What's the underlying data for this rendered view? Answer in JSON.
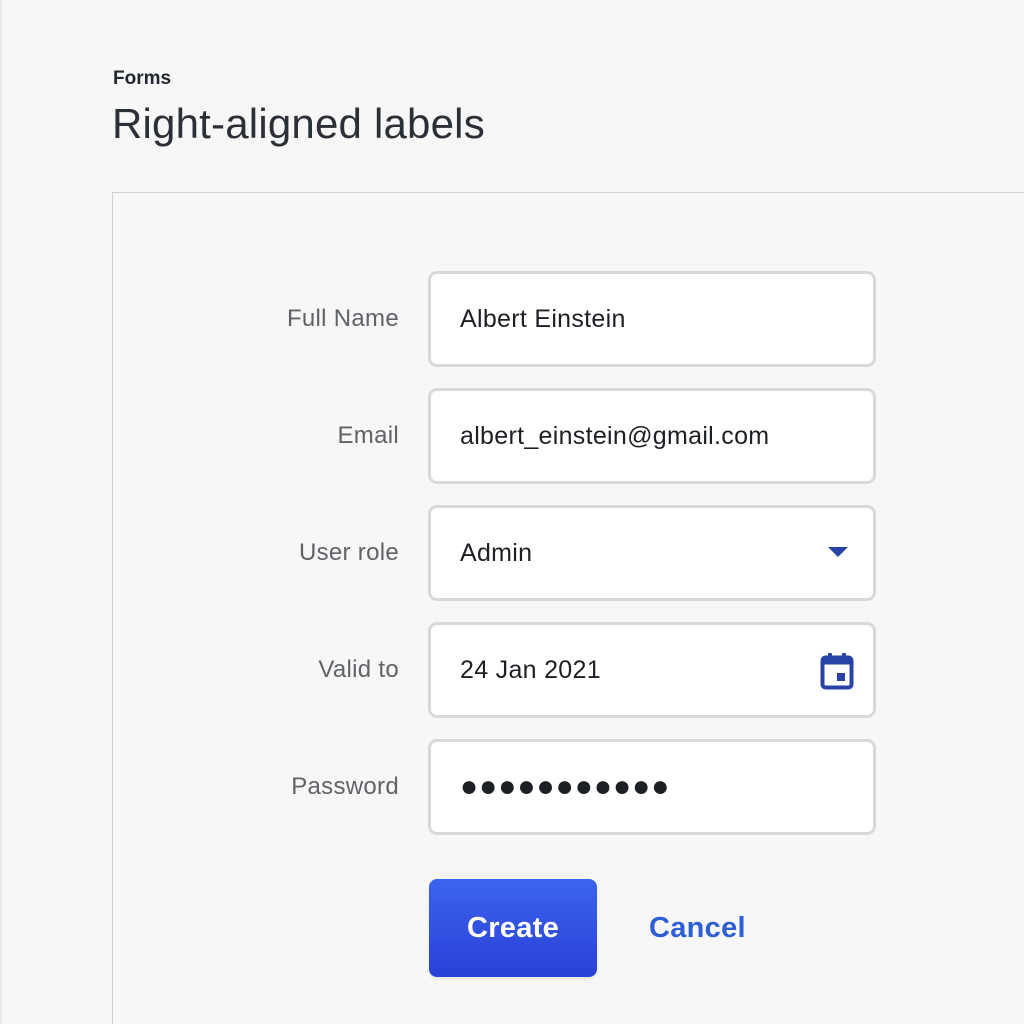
{
  "header": {
    "eyebrow": "Forms",
    "title": "Right-aligned labels"
  },
  "form": {
    "full_name": {
      "label": "Full Name",
      "value": "Albert Einstein"
    },
    "email": {
      "label": "Email",
      "value": "albert_einstein@gmail.com"
    },
    "user_role": {
      "label": "User role",
      "value": "Admin",
      "icon": "dropdown-caret-icon"
    },
    "valid_to": {
      "label": "Valid to",
      "value": "24 Jan 2021",
      "icon": "calendar-icon"
    },
    "password": {
      "label": "Password",
      "value": "●●●●●●●●●●●"
    }
  },
  "actions": {
    "create_label": "Create",
    "cancel_label": "Cancel"
  },
  "colors": {
    "accent": "#2f5fd6",
    "primary_button": "#3356e4",
    "icon": "#2743a8"
  }
}
